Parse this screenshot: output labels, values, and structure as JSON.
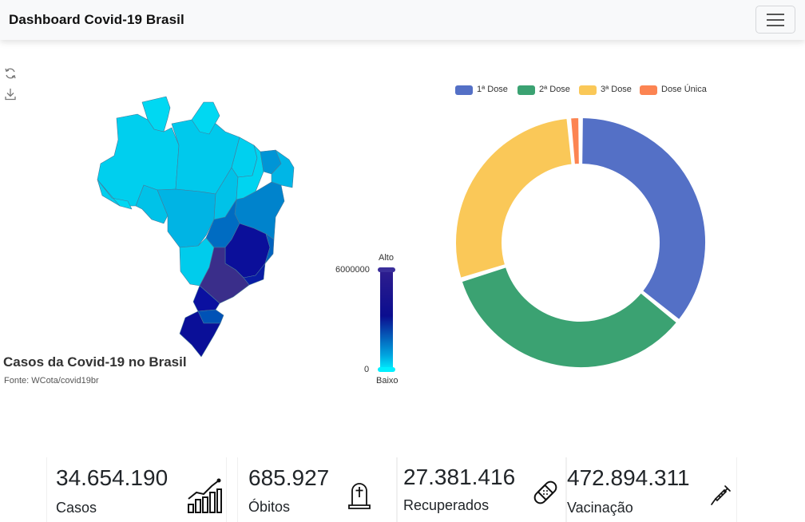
{
  "navbar": {
    "brand": "Dashboard Covid-19 Brasil",
    "menu_icon": "hamburger-icon"
  },
  "map": {
    "title": "Casos da Covid-19 no Brasil",
    "source": "Fonte: WCota/covid19br",
    "tools": [
      "refresh-icon",
      "download-icon"
    ],
    "visual_map": {
      "high_label": "Alto",
      "low_label": "Baixo",
      "max": "6000000",
      "min": "0"
    },
    "colors": {
      "high": "#2d1d8e",
      "mid": "#0b0d8f",
      "low": "#00f0ff"
    }
  },
  "chart_data": {
    "type": "pie",
    "legend_position": "top-center",
    "categories": [
      "1ª Dose",
      "2ª Dose",
      "3ª Dose",
      "Dose Única"
    ],
    "values": [
      35.8,
      34.4,
      28.3,
      1.5
    ],
    "colors": [
      "#5470c6",
      "#3ba272",
      "#fac858",
      "#fc8452"
    ]
  },
  "cards": [
    {
      "value": "34.654.190",
      "label": "Casos",
      "icon": "bar-chart-icon"
    },
    {
      "value": "685.927",
      "label": "Óbitos",
      "icon": "tombstone-icon"
    },
    {
      "value": "27.381.416",
      "label": "Recuperados",
      "icon": "bandage-icon"
    },
    {
      "value": "472.894.311",
      "label": "Vacinação",
      "icon": "syringe-icon"
    }
  ]
}
